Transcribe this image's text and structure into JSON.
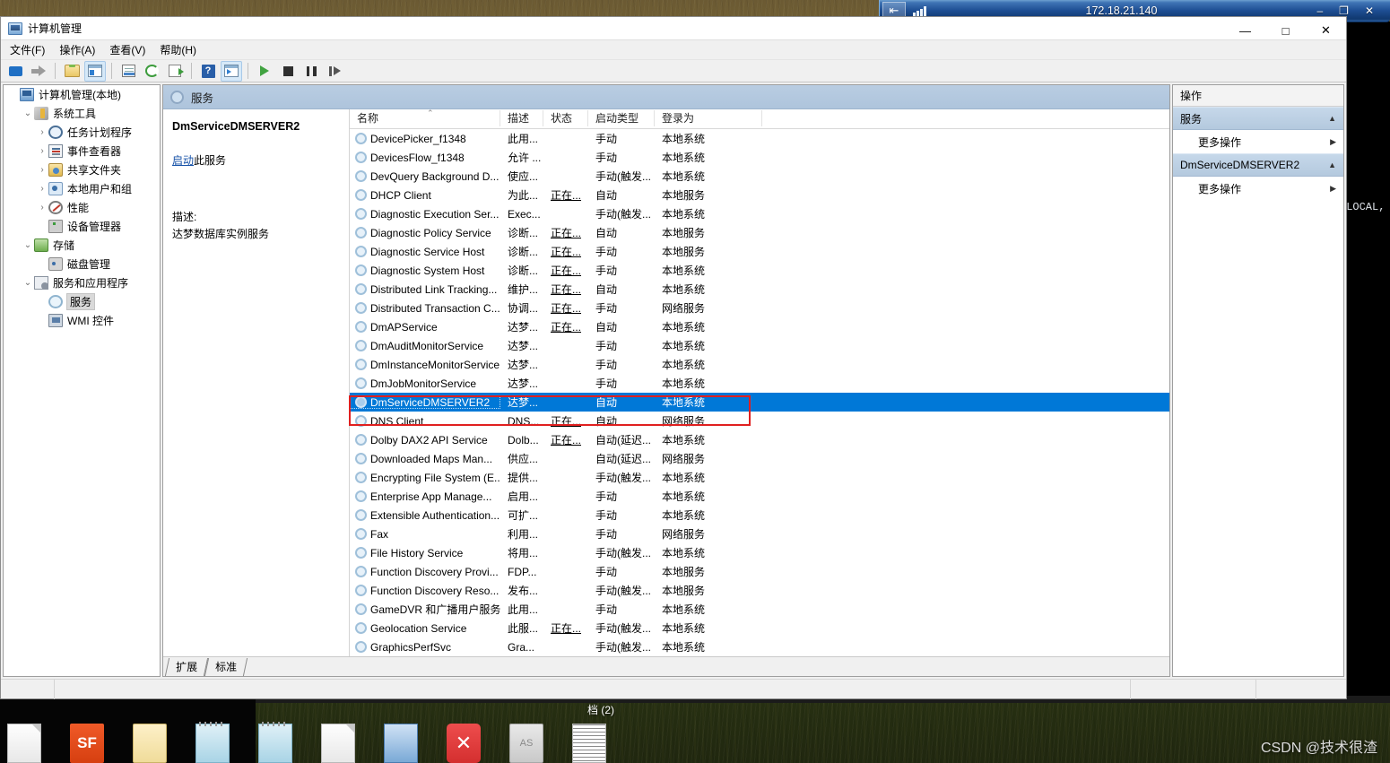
{
  "rdp_bar": {
    "title": "172.18.21.140",
    "pin_icon": "pin-icon",
    "signal_icon": "signal-bars-icon",
    "minimize_label": "–",
    "restore_label": "❐",
    "close_label": "✕"
  },
  "window": {
    "title": "计算机管理",
    "icon": "computer-management-icon",
    "minimize_label": "—",
    "maximize_label": "□",
    "close_label": "✕"
  },
  "menubar": [
    {
      "label": "文件(F)",
      "name": "menu-file"
    },
    {
      "label": "操作(A)",
      "name": "menu-action"
    },
    {
      "label": "查看(V)",
      "name": "menu-view"
    },
    {
      "label": "帮助(H)",
      "name": "menu-help"
    }
  ],
  "toolbar": [
    {
      "name": "back-button",
      "icon": "back-arrow-icon"
    },
    {
      "name": "forward-button",
      "icon": "forward-arrow-icon"
    },
    {
      "name": "up-folder-button",
      "icon": "folder-up-icon"
    },
    {
      "name": "show-hide-console-tree-button",
      "icon": "console-tree-icon"
    },
    {
      "name": "properties-button",
      "icon": "properties-icon"
    },
    {
      "name": "refresh-button",
      "icon": "refresh-icon"
    },
    {
      "name": "export-list-button",
      "icon": "export-list-icon"
    },
    {
      "name": "help-button",
      "icon": "help-icon"
    },
    {
      "name": "show-action-pane-button",
      "icon": "action-pane-icon"
    },
    {
      "name": "start-service-button",
      "icon": "play-icon"
    },
    {
      "name": "stop-service-button",
      "icon": "stop-icon"
    },
    {
      "name": "pause-service-button",
      "icon": "pause-icon"
    },
    {
      "name": "restart-service-button",
      "icon": "restart-icon"
    }
  ],
  "tree": [
    {
      "label": "计算机管理(本地)",
      "indent": 0,
      "expander": "",
      "icon": "computer-icon",
      "selected": false
    },
    {
      "label": "系统工具",
      "indent": 1,
      "expander": "⌄",
      "icon": "system-tools-icon",
      "selected": false
    },
    {
      "label": "任务计划程序",
      "indent": 2,
      "expander": "›",
      "icon": "task-scheduler-icon",
      "selected": false
    },
    {
      "label": "事件查看器",
      "indent": 2,
      "expander": "›",
      "icon": "event-viewer-icon",
      "selected": false
    },
    {
      "label": "共享文件夹",
      "indent": 2,
      "expander": "›",
      "icon": "shared-folders-icon",
      "selected": false
    },
    {
      "label": "本地用户和组",
      "indent": 2,
      "expander": "›",
      "icon": "local-users-groups-icon",
      "selected": false
    },
    {
      "label": "性能",
      "indent": 2,
      "expander": "›",
      "icon": "performance-icon",
      "selected": false
    },
    {
      "label": "设备管理器",
      "indent": 2,
      "expander": "",
      "icon": "device-manager-icon",
      "selected": false
    },
    {
      "label": "存储",
      "indent": 1,
      "expander": "⌄",
      "icon": "storage-icon",
      "selected": false
    },
    {
      "label": "磁盘管理",
      "indent": 2,
      "expander": "",
      "icon": "disk-management-icon",
      "selected": false
    },
    {
      "label": "服务和应用程序",
      "indent": 1,
      "expander": "⌄",
      "icon": "services-applications-icon",
      "selected": false
    },
    {
      "label": "服务",
      "indent": 2,
      "expander": "",
      "icon": "services-gear-icon",
      "selected": true
    },
    {
      "label": "WMI 控件",
      "indent": 2,
      "expander": "",
      "icon": "wmi-control-icon",
      "selected": false
    }
  ],
  "services_panel": {
    "header_title": "服务",
    "header_icon": "services-gear-icon"
  },
  "detail": {
    "service_name": "DmServiceDMSERVER2",
    "action_link": "启动",
    "action_link_suffix": "此服务",
    "description_label": "描述:",
    "description_text": "达梦数据库实例服务"
  },
  "list": {
    "columns": [
      {
        "label": "名称",
        "name": "column-name"
      },
      {
        "label": "描述",
        "name": "column-description"
      },
      {
        "label": "状态",
        "name": "column-status"
      },
      {
        "label": "启动类型",
        "name": "column-startup-type"
      },
      {
        "label": "登录为",
        "name": "column-log-on-as"
      }
    ],
    "sort_indicator": "⌃",
    "rows": [
      {
        "name": "DevicePicker_f1348",
        "desc": "此用...",
        "status": "",
        "startup": "手动",
        "logon": "本地系统",
        "selected": false
      },
      {
        "name": "DevicesFlow_f1348",
        "desc": "允许 ...",
        "status": "",
        "startup": "手动",
        "logon": "本地系统",
        "selected": false
      },
      {
        "name": "DevQuery Background D...",
        "desc": "使应...",
        "status": "",
        "startup": "手动(触发...",
        "logon": "本地系统",
        "selected": false
      },
      {
        "name": "DHCP Client",
        "desc": "为此...",
        "status": "正在...",
        "startup": "自动",
        "logon": "本地服务",
        "selected": false
      },
      {
        "name": "Diagnostic Execution Ser...",
        "desc": "Exec...",
        "status": "",
        "startup": "手动(触发...",
        "logon": "本地系统",
        "selected": false
      },
      {
        "name": "Diagnostic Policy Service",
        "desc": "诊断...",
        "status": "正在...",
        "startup": "自动",
        "logon": "本地服务",
        "selected": false
      },
      {
        "name": "Diagnostic Service Host",
        "desc": "诊断...",
        "status": "正在...",
        "startup": "手动",
        "logon": "本地服务",
        "selected": false
      },
      {
        "name": "Diagnostic System Host",
        "desc": "诊断...",
        "status": "正在...",
        "startup": "手动",
        "logon": "本地系统",
        "selected": false
      },
      {
        "name": "Distributed Link Tracking...",
        "desc": "维护...",
        "status": "正在...",
        "startup": "自动",
        "logon": "本地系统",
        "selected": false
      },
      {
        "name": "Distributed Transaction C...",
        "desc": "协调...",
        "status": "正在...",
        "startup": "手动",
        "logon": "网络服务",
        "selected": false
      },
      {
        "name": "DmAPService",
        "desc": "达梦...",
        "status": "正在...",
        "startup": "自动",
        "logon": "本地系统",
        "selected": false
      },
      {
        "name": "DmAuditMonitorService",
        "desc": "达梦...",
        "status": "",
        "startup": "手动",
        "logon": "本地系统",
        "selected": false
      },
      {
        "name": "DmInstanceMonitorService",
        "desc": "达梦...",
        "status": "",
        "startup": "手动",
        "logon": "本地系统",
        "selected": false
      },
      {
        "name": "DmJobMonitorService",
        "desc": "达梦...",
        "status": "",
        "startup": "手动",
        "logon": "本地系统",
        "selected": false
      },
      {
        "name": "DmServiceDMSERVER2",
        "desc": "达梦...",
        "status": "",
        "startup": "自动",
        "logon": "本地系统",
        "selected": true
      },
      {
        "name": "DNS Client",
        "desc": "DNS...",
        "status": "正在...",
        "startup": "自动",
        "logon": "网络服务",
        "selected": false
      },
      {
        "name": "Dolby DAX2 API Service",
        "desc": "Dolb...",
        "status": "正在...",
        "startup": "自动(延迟...",
        "logon": "本地系统",
        "selected": false
      },
      {
        "name": "Downloaded Maps Man...",
        "desc": "供应...",
        "status": "",
        "startup": "自动(延迟...",
        "logon": "网络服务",
        "selected": false
      },
      {
        "name": "Encrypting File System (E...",
        "desc": "提供...",
        "status": "",
        "startup": "手动(触发...",
        "logon": "本地系统",
        "selected": false
      },
      {
        "name": "Enterprise App Manage...",
        "desc": "启用...",
        "status": "",
        "startup": "手动",
        "logon": "本地系统",
        "selected": false
      },
      {
        "name": "Extensible Authentication...",
        "desc": "可扩...",
        "status": "",
        "startup": "手动",
        "logon": "本地系统",
        "selected": false
      },
      {
        "name": "Fax",
        "desc": "利用...",
        "status": "",
        "startup": "手动",
        "logon": "网络服务",
        "selected": false
      },
      {
        "name": "File History Service",
        "desc": "将用...",
        "status": "",
        "startup": "手动(触发...",
        "logon": "本地系统",
        "selected": false
      },
      {
        "name": "Function Discovery Provi...",
        "desc": "FDP...",
        "status": "",
        "startup": "手动",
        "logon": "本地服务",
        "selected": false
      },
      {
        "name": "Function Discovery Reso...",
        "desc": "发布...",
        "status": "",
        "startup": "手动(触发...",
        "logon": "本地服务",
        "selected": false
      },
      {
        "name": "GameDVR 和广播用户服务...",
        "desc": "此用...",
        "status": "",
        "startup": "手动",
        "logon": "本地系统",
        "selected": false
      },
      {
        "name": "Geolocation Service",
        "desc": "此服...",
        "status": "正在...",
        "startup": "手动(触发...",
        "logon": "本地系统",
        "selected": false
      },
      {
        "name": "GraphicsPerfSvc",
        "desc": "Gra...",
        "status": "",
        "startup": "手动(触发...",
        "logon": "本地系统",
        "selected": false
      }
    ],
    "scroll_up_icon": "⌃",
    "scroll_down_icon": "⌄"
  },
  "tabs": [
    {
      "label": "扩展",
      "name": "tab-extended"
    },
    {
      "label": "标准",
      "name": "tab-standard"
    }
  ],
  "actions": {
    "title": "操作",
    "groups": [
      {
        "header": "服务",
        "collapse_icon": "▲",
        "items": [
          {
            "label": "更多操作",
            "submenu_icon": "▶"
          }
        ]
      },
      {
        "header": "DmServiceDMSERVER2",
        "collapse_icon": "▲",
        "items": [
          {
            "label": "更多操作",
            "submenu_icon": "▶"
          }
        ]
      }
    ]
  },
  "background": {
    "console_text": "=LOCAL,",
    "desktop_label": "档 (2)",
    "watermark": "CSDN @技术很渣"
  },
  "annotation": {
    "highlight_color": "#e02020",
    "target_row": "DmServiceDMSERVER2"
  }
}
